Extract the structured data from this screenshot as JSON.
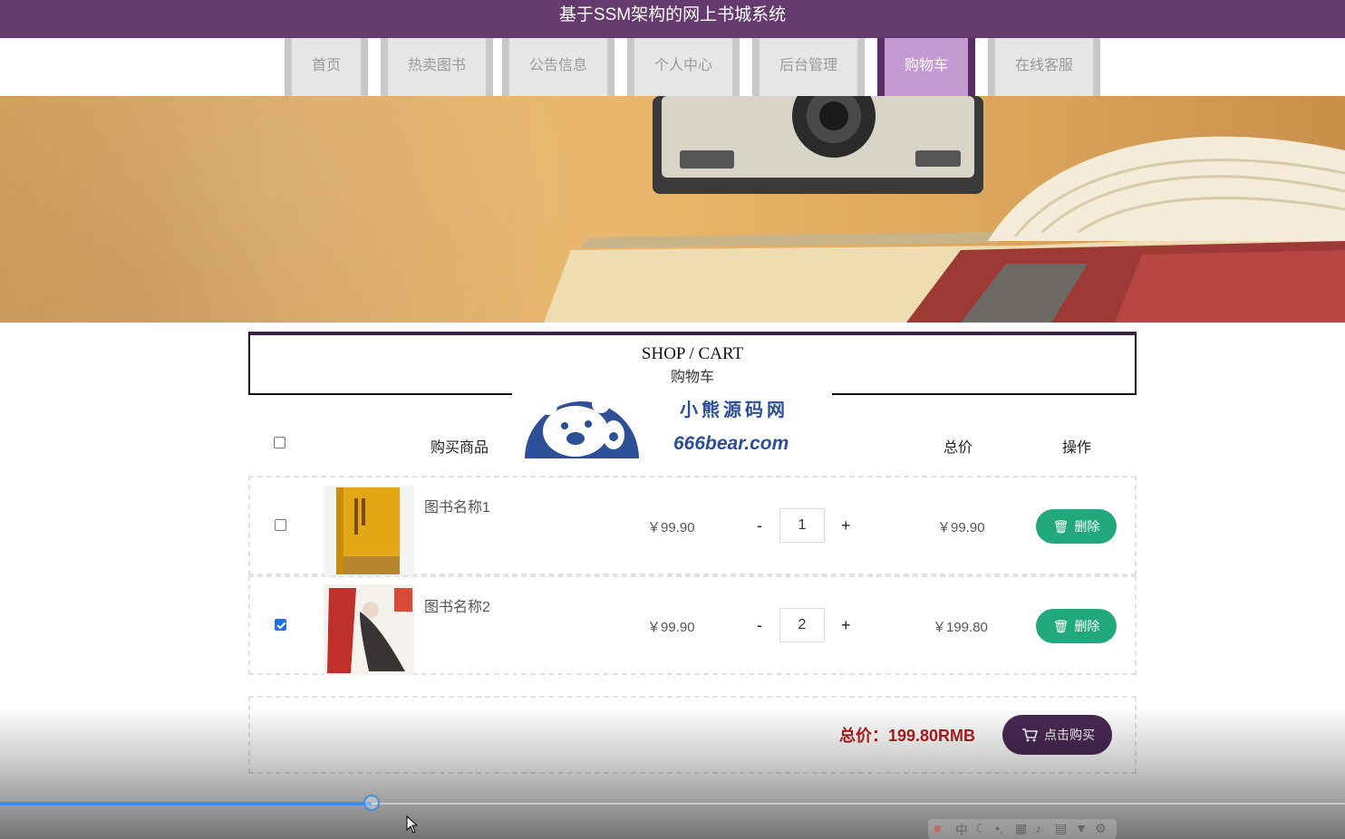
{
  "header": {
    "title": "基于SSM架构的网上书城系统"
  },
  "nav": {
    "items": [
      {
        "label": "首页",
        "active": false
      },
      {
        "label": "热卖图书",
        "active": false
      },
      {
        "label": "公告信息",
        "active": false
      },
      {
        "label": "个人中心",
        "active": false
      },
      {
        "label": "后台管理",
        "active": false
      },
      {
        "label": "购物车",
        "active": true
      },
      {
        "label": "在线客服",
        "active": false
      }
    ]
  },
  "cart_title": {
    "en": "SHOP / CART",
    "cn": "购物车"
  },
  "watermark": {
    "name": "小熊源码网",
    "url": "666bear.com"
  },
  "table": {
    "headers": {
      "product": "购买商品",
      "subtotal": "总价",
      "action": "操作"
    },
    "rows": [
      {
        "name": "图书名称1",
        "price": "￥99.90",
        "quantity": "1",
        "subtotal": "￥99.90",
        "checked": false,
        "delete_label": "删除",
        "minus": "-",
        "plus": "+"
      },
      {
        "name": "图书名称2",
        "price": "￥99.90",
        "quantity": "2",
        "subtotal": "￥199.80",
        "checked": true,
        "delete_label": "删除",
        "minus": "-",
        "plus": "+"
      }
    ]
  },
  "summary": {
    "total": "总价：199.80RMB",
    "buy_label": "点击购买"
  },
  "video": {
    "progress": 0.276
  },
  "colors": {
    "header": "#653a6e",
    "nav_active": "#c49ad0",
    "delete_button": "#21a87d",
    "buy_button": "#4a2955",
    "total_text": "#b31f1f"
  }
}
